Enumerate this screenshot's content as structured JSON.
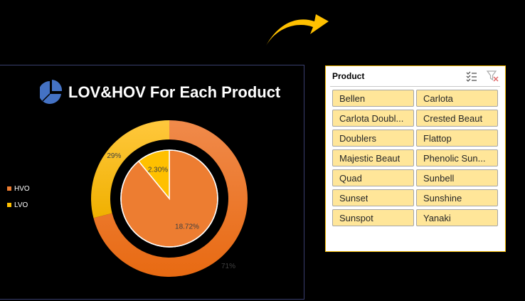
{
  "chart": {
    "title": "LOV&HOV For Each Product",
    "legend": [
      {
        "label": "HVO",
        "color": "#ed7d31"
      },
      {
        "label": "LVO",
        "color": "#ffc000"
      }
    ],
    "icon": "pie-chart-icon"
  },
  "chart_data": {
    "type": "pie",
    "title": "LOV&HOV For Each Product",
    "series": [
      {
        "ring": "outer",
        "categories": [
          "HVO",
          "LVO"
        ],
        "values": [
          71,
          29
        ],
        "labels": [
          "71%",
          "29%"
        ]
      },
      {
        "ring": "inner",
        "categories": [
          "HVO",
          "LVO"
        ],
        "values": [
          18.72,
          2.3
        ],
        "labels": [
          "18.72%",
          "2.30%"
        ]
      }
    ],
    "legend": "left",
    "colors": {
      "HVO": "#ed7d31",
      "LVO": "#ffc000"
    }
  },
  "slicer": {
    "title": "Product",
    "icons": [
      "multi-select-icon",
      "clear-filter-icon"
    ],
    "border_color": "#f2b800",
    "item_color": "#ffe699",
    "items": [
      "Bellen",
      "Carlota",
      "Carlota Doubl...",
      "Crested Beaut",
      "Doublers",
      "Flattop",
      "Majestic Beaut",
      "Phenolic Sun...",
      "Quad",
      "Sunbell",
      "Sunset",
      "Sunshine",
      "Sunspot",
      "Yanaki"
    ]
  },
  "decoration": {
    "arrow_color": "#ffc000",
    "arrow_icon": "curved-arrow-icon"
  }
}
